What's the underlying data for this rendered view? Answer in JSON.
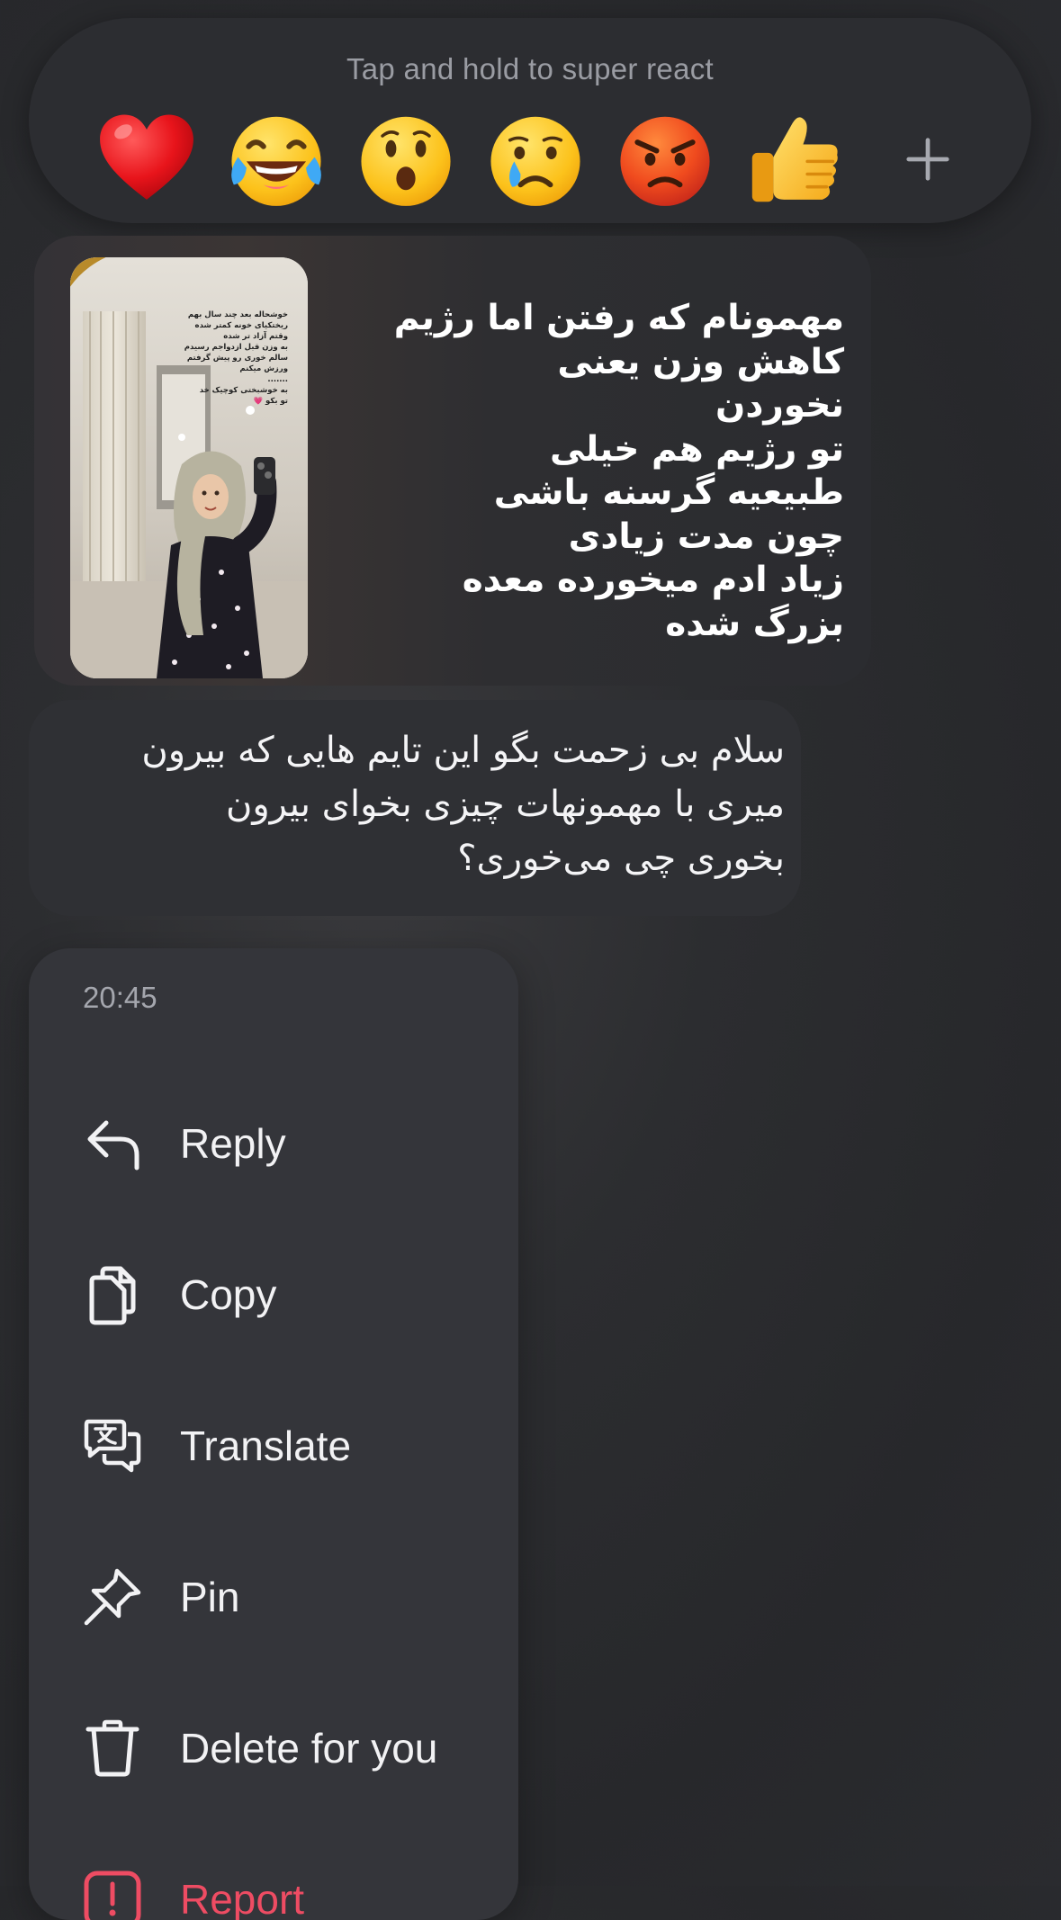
{
  "reactions": {
    "hint": "Tap and hold to super react",
    "items": [
      {
        "name": "heart",
        "glyph": "❤️"
      },
      {
        "name": "joy",
        "glyph": "😂"
      },
      {
        "name": "surprised",
        "glyph": "😮"
      },
      {
        "name": "sad",
        "glyph": "😢"
      },
      {
        "name": "angry",
        "glyph": "😡"
      },
      {
        "name": "thumbs-up",
        "glyph": "👍"
      }
    ],
    "more_icon": "plus-icon"
  },
  "story": {
    "caption": "مهمونام که رفتن اما رژیم\nکاهش وزن یعنی\nنخوردن\nتو رژیم هم خیلی\nطبیعیه گرسنه باشی\nچون مدت زیادی\nزیاد ادم میخورده معده\nبزرگ شده",
    "thumbnail_overlay": "خوشحاله بعد چند سال بهم\nریختکیای خونه کمتر شده\nوقتم آزاد تر شده\nبه وزن قبل ازدواجم رسیدم\nسالم خوری رو پیش گرفتم\nورزش میکنم\n.......\nبه خوشبختی کوچیک خد\nتو بکو 💗"
  },
  "message": {
    "text": "سلام بی زحمت بگو این تایم هایی که بیرون\nمیری با مهمونهات چیزی بخوای بیرون\nبخوری چی می‌خوری؟"
  },
  "menu": {
    "time": "20:45",
    "items": [
      {
        "label": "Reply",
        "icon": "reply-icon"
      },
      {
        "label": "Copy",
        "icon": "copy-icon"
      },
      {
        "label": "Translate",
        "icon": "translate-icon"
      },
      {
        "label": "Pin",
        "icon": "pin-icon"
      },
      {
        "label": "Delete for you",
        "icon": "trash-icon"
      },
      {
        "label": "Report",
        "icon": "report-icon"
      }
    ]
  },
  "colors": {
    "background": "#2b2c30",
    "surface": "#34353a",
    "text": "#f2f2f4",
    "muted": "#a4a6ad",
    "danger": "#ee4c63"
  }
}
